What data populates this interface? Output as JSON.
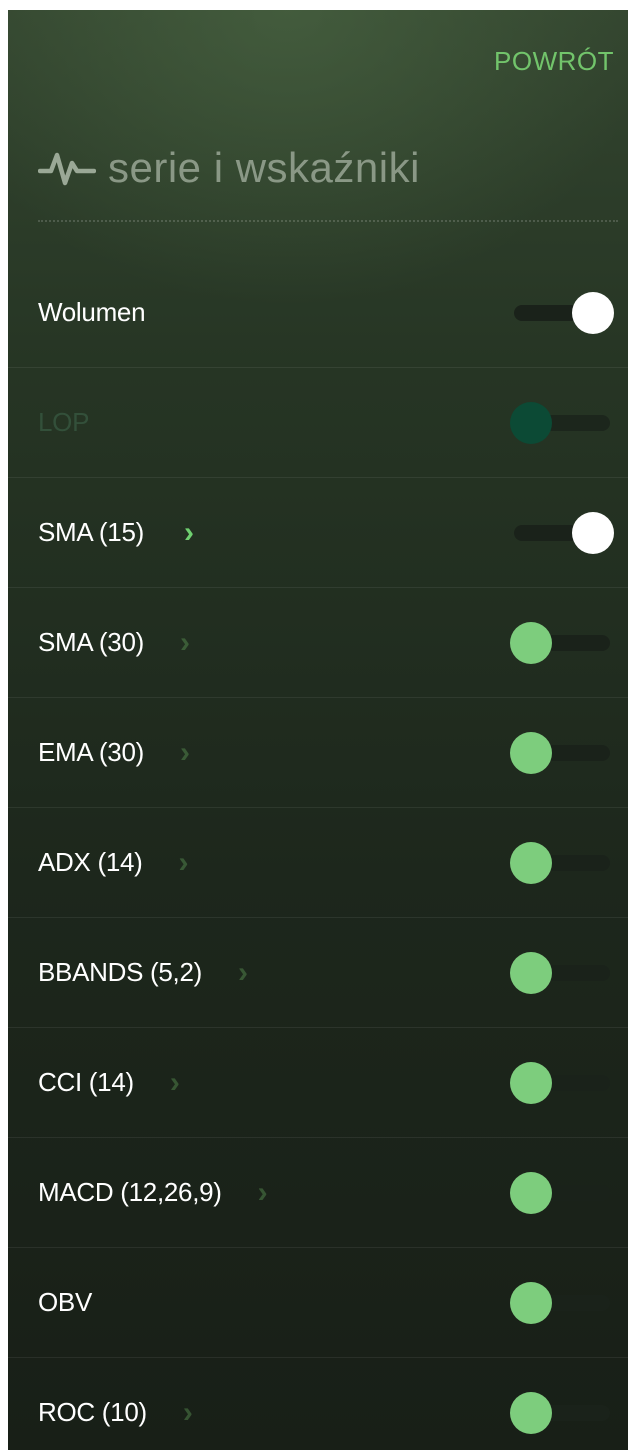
{
  "header": {
    "back_label": "POWRÓT",
    "title": "serie i wskaźniki",
    "title_icon": "pulse-icon"
  },
  "colors": {
    "accent": "#72c46b",
    "toggle_off_knob": "#7dcd7d",
    "toggle_on_knob": "#ffffff",
    "toggle_disabled_knob": "#0c4a35"
  },
  "items": [
    {
      "label": "Wolumen",
      "has_settings": false,
      "enabled": true,
      "state": "on"
    },
    {
      "label": "LOP",
      "has_settings": false,
      "enabled": false,
      "state": "disabled"
    },
    {
      "label": "SMA (15)",
      "has_settings": true,
      "enabled": true,
      "state": "on"
    },
    {
      "label": "SMA (30)",
      "has_settings": true,
      "enabled": true,
      "state": "off"
    },
    {
      "label": "EMA (30)",
      "has_settings": true,
      "enabled": true,
      "state": "off"
    },
    {
      "label": "ADX (14)",
      "has_settings": true,
      "enabled": true,
      "state": "off"
    },
    {
      "label": "BBANDS (5,2)",
      "has_settings": true,
      "enabled": true,
      "state": "off"
    },
    {
      "label": "CCI (14)",
      "has_settings": true,
      "enabled": true,
      "state": "off"
    },
    {
      "label": "MACD (12,26,9)",
      "has_settings": true,
      "enabled": true,
      "state": "off"
    },
    {
      "label": "OBV",
      "has_settings": false,
      "enabled": true,
      "state": "off"
    },
    {
      "label": "ROC (10)",
      "has_settings": true,
      "enabled": true,
      "state": "off"
    }
  ]
}
